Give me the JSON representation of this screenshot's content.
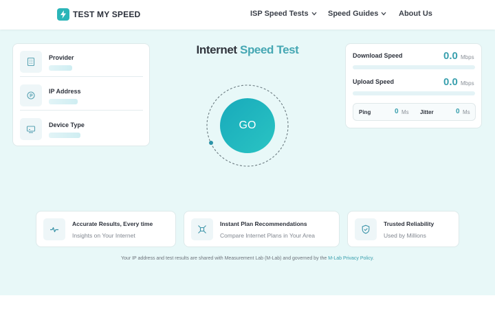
{
  "header": {
    "logo_text": "TEST MY SPEED",
    "nav": {
      "isp_tests": "ISP Speed Tests",
      "speed_guides": "Speed Guides",
      "about": "About Us"
    }
  },
  "info_card": {
    "provider_label": "Provider",
    "ip_label": "IP Address",
    "device_label": "Device Type"
  },
  "title": {
    "part1": "Internet",
    "part2": " Speed Test"
  },
  "go_button": {
    "label": "GO"
  },
  "speed": {
    "download_label": "Download Speed",
    "download_value": "0.0",
    "download_unit": "Mbps",
    "download_progress": 0,
    "upload_label": "Upload Speed",
    "upload_value": "0.0",
    "upload_unit": "Mbps",
    "upload_progress": 0,
    "ping_label": "Ping",
    "ping_value": "0",
    "ping_unit": "Ms",
    "jitter_label": "Jitter",
    "jitter_value": "0",
    "jitter_unit": "Ms"
  },
  "features": [
    {
      "title": "Accurate Results, Every time",
      "subtitle": "Insights on Your Internet",
      "icon": "pulse-icon"
    },
    {
      "title": "Instant Plan Recommendations",
      "subtitle": "Compare Internet Plans in Your Area",
      "icon": "compare-icon"
    },
    {
      "title": "Trusted Reliability",
      "subtitle": "Used by Millions",
      "icon": "shield-check-icon"
    }
  ],
  "footnote": {
    "text": "Your IP address and test results are shared with Measurement Lab (M-Lab) and governed by the ",
    "link": "M-Lab Privacy Policy",
    "end": "."
  },
  "colors": {
    "accent": "#3aa0ae",
    "brand": "#2bb5b8",
    "background_band": "#e8f8f8"
  }
}
